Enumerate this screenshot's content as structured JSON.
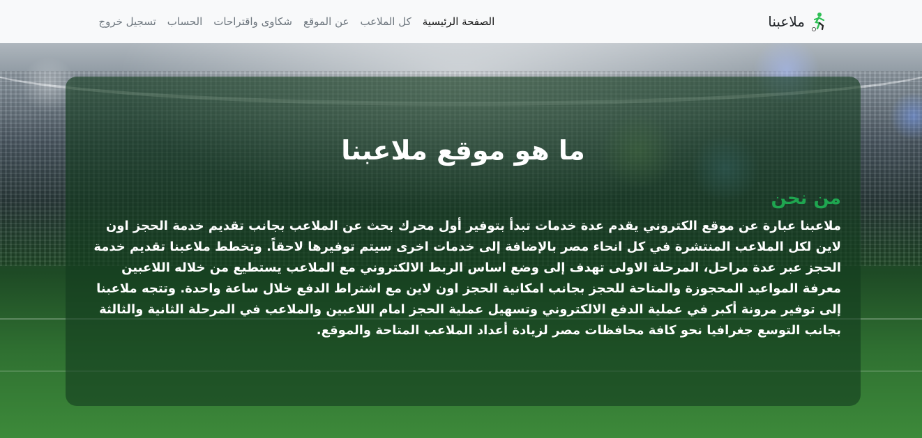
{
  "navbar": {
    "brand": "ملاعبنا",
    "items": [
      {
        "label": "الصفحة الرئيسية",
        "active": true
      },
      {
        "label": "كل الملاعب",
        "active": false
      },
      {
        "label": "عن الموقع",
        "active": false
      },
      {
        "label": "شكاوى واقتراحات",
        "active": false
      },
      {
        "label": "الحساب",
        "active": false
      },
      {
        "label": "تسجيل خروج",
        "active": false
      }
    ]
  },
  "hero": {
    "title": "ما هو موقع ملاعبنا",
    "about_heading": "من نحن",
    "about_text": "ملاعبنا عبارة عن موقع الكتروني يقدم عدة خدمات تبدأ بتوفير أول محرك بحث عن الملاعب بجانب تقديم خدمة الحجز اون لاين لكل الملاعب المنتشرة في كل انحاء مصر بالإضافة إلى خدمات اخرى سيتم توفيرها لاحقاً. وتخطط ملاعبنا تقديم خدمة الحجز عبر عدة مراحل، المرحلة الاولى تهدف إلى وضع اساس الربط الالكتروني مع الملاعب يستطيع من خلاله اللاعبين معرفة المواعيد المحجوزة والمتاحة للحجز بجانب امكانية الحجز اون لاين مع اشتراط الدفع خلال ساعة واحدة. وتتجه ملاعبنا إلى توفير مرونة أكبر في عملية الدفع الالكتروني وتسهيل عملية الحجز امام اللاعبين والملاعب في المرحلة الثانية والثالثة بجانب التوسع جغرافيا نحو كافة محافظات مصر لزيادة أعداد الملاعب المتاحة والموقع."
  },
  "colors": {
    "navbar_bg": "#f8f9fa",
    "accent_green": "#1fa650",
    "card_bg": "rgba(20, 60, 30, 0.62)",
    "text_white": "#ffffff"
  },
  "icons": {
    "brand_logo": "soccer-player-icon"
  }
}
